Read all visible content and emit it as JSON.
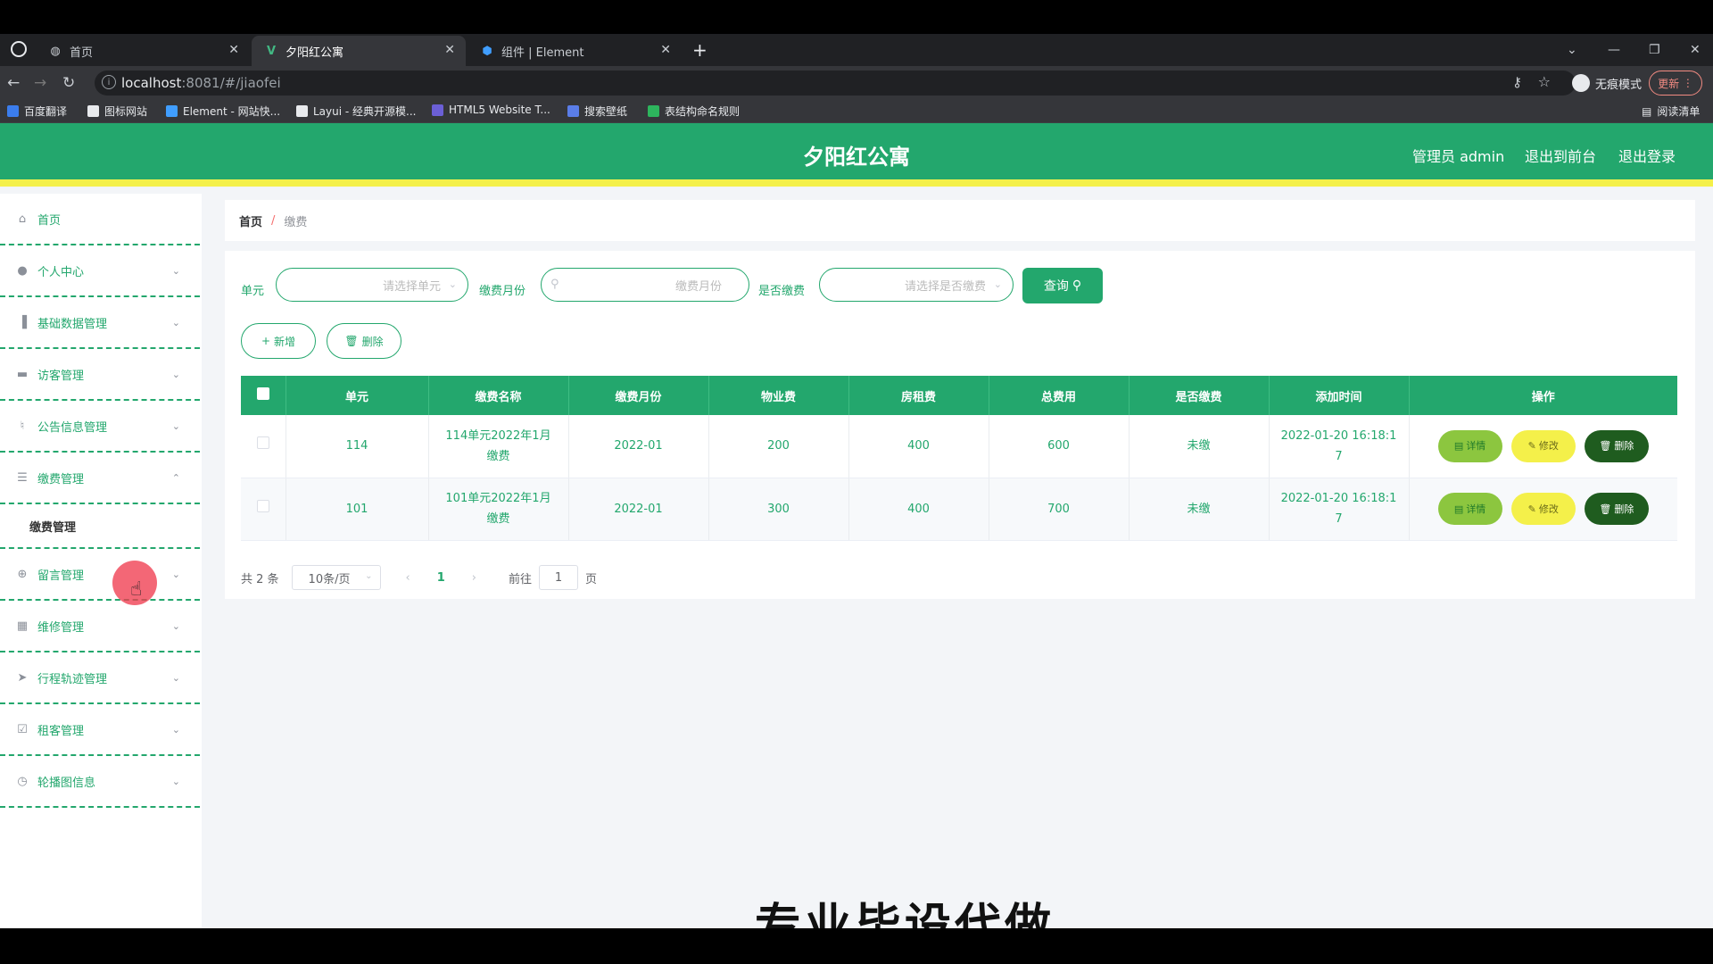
{
  "browser": {
    "tabs": [
      {
        "title": "首页",
        "icon": "globe-icon"
      },
      {
        "title": "夕阳红公寓",
        "icon": "vue-icon"
      },
      {
        "title": "组件 | Element",
        "icon": "element-icon"
      }
    ],
    "url_host": "localhost",
    "url_rest": ":8081/#/jiaofei",
    "incognito_label": "无痕模式",
    "update_label": "更新",
    "reading_list": "阅读清单",
    "bookmarks": [
      "百度翻译",
      "图标网站",
      "Element - 网站快...",
      "Layui - 经典开源模...",
      "HTML5 Website T...",
      "搜索壁纸",
      "表结构命名规则"
    ]
  },
  "header": {
    "title": "夕阳红公寓",
    "admin_label": "管理员 admin",
    "front_label": "退出到前台",
    "logout_label": "退出登录"
  },
  "sidebar": {
    "items": [
      {
        "label": "首页",
        "icon": "home-icon",
        "chevron": ""
      },
      {
        "label": "个人中心",
        "icon": "user-icon",
        "chevron": "⌄"
      },
      {
        "label": "基础数据管理",
        "icon": "chart-icon",
        "chevron": "⌄"
      },
      {
        "label": "访客管理",
        "icon": "monitor-icon",
        "chevron": "⌄"
      },
      {
        "label": "公告信息管理",
        "icon": "mic-icon",
        "chevron": "⌄"
      },
      {
        "label": "缴费管理",
        "icon": "sliders-icon",
        "chevron": "⌃"
      },
      {
        "label": "留言管理",
        "icon": "compass-icon",
        "chevron": "⌄"
      },
      {
        "label": "维修管理",
        "icon": "grid-icon",
        "chevron": "⌄"
      },
      {
        "label": "行程轨迹管理",
        "icon": "send-icon",
        "chevron": "⌄"
      },
      {
        "label": "租客管理",
        "icon": "calendar-check-icon",
        "chevron": "⌄"
      },
      {
        "label": "轮播图信息",
        "icon": "clock-icon",
        "chevron": "⌄"
      }
    ],
    "submenu_label": "缴费管理"
  },
  "breadcrumb": {
    "home": "首页",
    "separator": "/",
    "current": "缴费"
  },
  "filters": {
    "unit_label": "单元",
    "unit_placeholder": "请选择单元",
    "month_label": "缴费月份",
    "month_placeholder": "缴费月份",
    "paid_label": "是否缴费",
    "paid_placeholder": "请选择是否缴费",
    "query_label": "查询"
  },
  "actions": {
    "add_label": "新增",
    "delete_label": "删除"
  },
  "table": {
    "headers": [
      "单元",
      "缴费名称",
      "缴费月份",
      "物业费",
      "房租费",
      "总费用",
      "是否缴费",
      "添加时间",
      "操作"
    ],
    "rows": [
      {
        "unit": "114",
        "name1": "114单元2022年1月",
        "name2": "缴费",
        "month": "2022-01",
        "property": "200",
        "rent": "400",
        "total": "600",
        "paid": "未缴",
        "time1": "2022-01-20 16:18:1",
        "time2": "7"
      },
      {
        "unit": "101",
        "name1": "101单元2022年1月",
        "name2": "缴费",
        "month": "2022-01",
        "property": "300",
        "rent": "400",
        "total": "700",
        "paid": "未缴",
        "time1": "2022-01-20 16:18:1",
        "time2": "7"
      }
    ],
    "op_detail": "详情",
    "op_edit": "修改",
    "op_delete": "删除"
  },
  "pagination": {
    "total": "共 2 条",
    "page_size": "10条/页",
    "current_page": "1",
    "goto_label": "前往",
    "goto_value": "1",
    "page_suffix": "页"
  },
  "overlay": {
    "caption": "专业毕设代做"
  },
  "colors": {
    "primary": "#23a76d",
    "accent_yellow": "#f4f04a",
    "detail_green": "#8cc63f",
    "delete_dark": "#1f5c1f"
  }
}
